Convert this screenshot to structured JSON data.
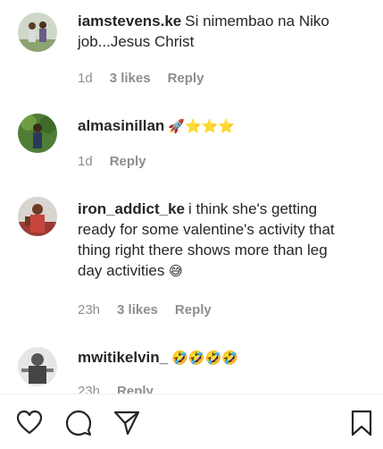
{
  "comments": [
    {
      "username": "iamstevens.ke",
      "text_line1": "Si nimembao na Niko",
      "text_line2": "job...Jesus Christ",
      "time": "1d",
      "likes": "3 likes",
      "reply": "Reply"
    },
    {
      "username": "almasinillan",
      "emoji": "🚀⭐⭐⭐",
      "time": "1d",
      "reply": "Reply"
    },
    {
      "username": "iron_addict_ke",
      "text_line1": "i think she's getting",
      "text_line2": "ready for some valentine's activity that",
      "text_line3": "thing right there shows more than leg",
      "text_line4": "day activities",
      "emoji": "😅",
      "time": "23h",
      "likes": "3 likes",
      "reply": "Reply"
    },
    {
      "username": "mwitikelvin_",
      "emoji": "🤣🤣🤣🤣",
      "time": "23h",
      "reply": "Reply"
    }
  ],
  "action_bar": {
    "icons": [
      "heart-icon",
      "comment-icon",
      "share-icon",
      "bookmark-icon"
    ]
  },
  "colors": {
    "text": "#262626",
    "muted": "#8e8e8e",
    "background": "#ffffff"
  }
}
